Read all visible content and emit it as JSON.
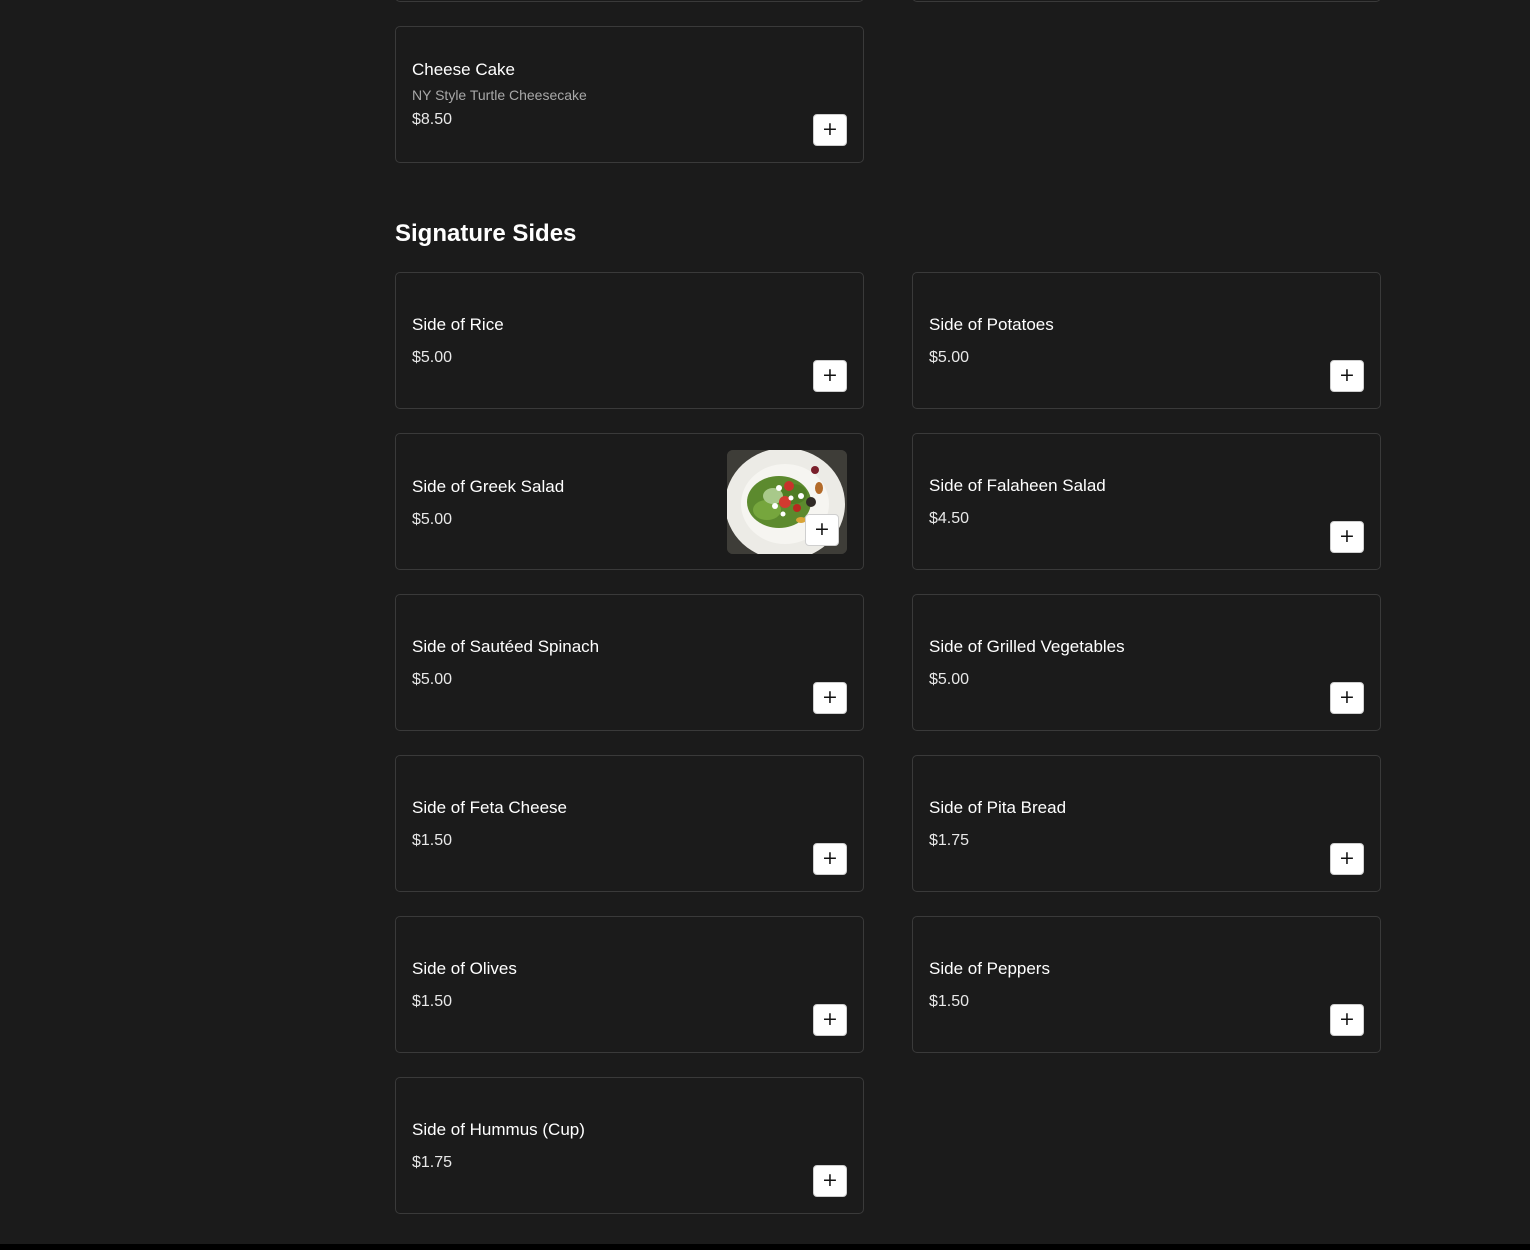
{
  "add_symbol": "+",
  "desserts": {
    "items": [
      {
        "name": "Cheese Cake",
        "description": "NY Style Turtle Cheesecake",
        "price": "$8.50"
      }
    ]
  },
  "signature_sides": {
    "title": "Signature Sides",
    "items": [
      {
        "name": "Side of Rice",
        "price": "$5.00"
      },
      {
        "name": "Side of Potatoes",
        "price": "$5.00"
      },
      {
        "name": "Side of Greek Salad",
        "price": "$5.00",
        "has_image": true
      },
      {
        "name": "Side of Falaheen Salad",
        "price": "$4.50"
      },
      {
        "name": "Side of Sautéed Spinach",
        "price": "$5.00"
      },
      {
        "name": "Side of Grilled Vegetables",
        "price": "$5.00"
      },
      {
        "name": "Side of Feta Cheese",
        "price": "$1.50"
      },
      {
        "name": "Side of Pita Bread",
        "price": "$1.75"
      },
      {
        "name": "Side of Olives",
        "price": "$1.50"
      },
      {
        "name": "Side of Peppers",
        "price": "$1.50"
      },
      {
        "name": "Side of Hummus (Cup)",
        "price": "$1.75"
      }
    ]
  },
  "colors": {
    "background": "#1b1b1b",
    "card_border": "#3a3a3a",
    "button_bg": "#ffffff"
  }
}
